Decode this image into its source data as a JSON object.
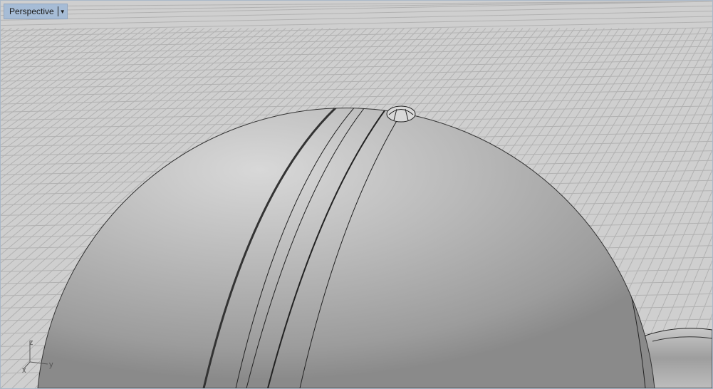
{
  "viewport": {
    "title": "Perspective",
    "menu_icon": "chevron-down-icon"
  },
  "axes": {
    "x": "x",
    "y": "y",
    "z": "z"
  },
  "colors": {
    "background": "#cfcfcf",
    "grid": "#b2b2b2",
    "title_bg": "#a6bcd6",
    "object": "#b4b4b4"
  }
}
